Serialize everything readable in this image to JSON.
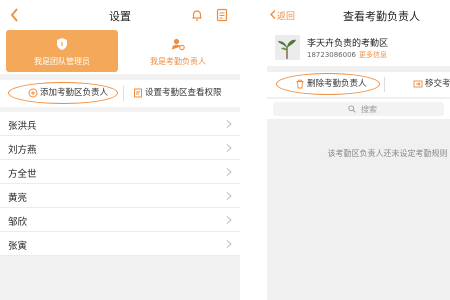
{
  "left": {
    "header": {
      "title": "设置"
    },
    "role_tabs": [
      {
        "label": "我是团队管理员",
        "active": true
      },
      {
        "label": "我是考勤负责人",
        "active": false
      }
    ],
    "actions": {
      "add_label": "添加考勤区负责人",
      "permission_label": "设置考勤区查看权限"
    },
    "names": [
      "张洪兵",
      "刘方燕",
      "方全世",
      "黄亮",
      "邹欣",
      "张寅"
    ]
  },
  "right": {
    "header": {
      "back_label": "返回",
      "title": "查看考勤负责人"
    },
    "profile": {
      "name": "李天卉负责的考勤区",
      "phone": "18723086006",
      "more": "更多信息"
    },
    "actions": {
      "delete_label": "删除考勤负责人",
      "transfer_label": "移交考"
    },
    "search": {
      "placeholder": "搜索"
    },
    "empty_text": "该考勤区负责人还未设定考勤规则"
  },
  "colors": {
    "accent": "#f08c3a",
    "tab_active_bg": "#f4a85a"
  }
}
